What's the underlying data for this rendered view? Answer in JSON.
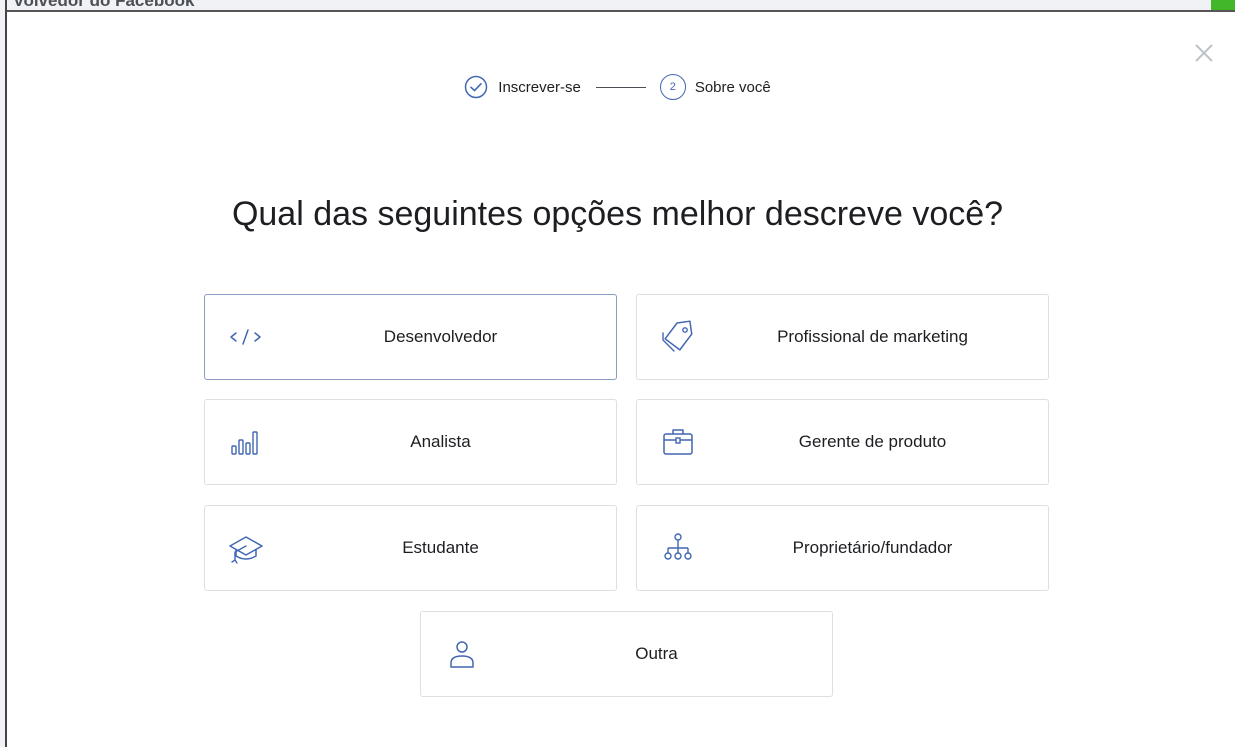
{
  "backdrop": {
    "title_fragment": "volvedor do Facebook"
  },
  "stepper": {
    "steps": [
      {
        "label": "Inscrever-se",
        "status": "completed",
        "icon": "check-circle-icon"
      },
      {
        "label": "Sobre você",
        "status": "current",
        "number": "2"
      }
    ]
  },
  "question": "Qual das seguintes opções melhor descreve você?",
  "options": [
    {
      "label": "Desenvolvedor",
      "icon": "code-icon",
      "selected": true
    },
    {
      "label": "Profissional de marketing",
      "icon": "tag-icon",
      "selected": false
    },
    {
      "label": "Analista",
      "icon": "bar-chart-icon",
      "selected": false
    },
    {
      "label": "Gerente de produto",
      "icon": "briefcase-icon",
      "selected": false
    },
    {
      "label": "Estudante",
      "icon": "graduation-cap-icon",
      "selected": false
    },
    {
      "label": "Proprietário/fundador",
      "icon": "org-chart-icon",
      "selected": false
    },
    {
      "label": "Outra",
      "icon": "person-icon",
      "selected": false
    }
  ],
  "colors": {
    "accent": "#4267b2",
    "selected_border": "#8b9dc3",
    "border": "#dddfe2",
    "text": "#1c1e21",
    "close": "#bec3c9"
  }
}
